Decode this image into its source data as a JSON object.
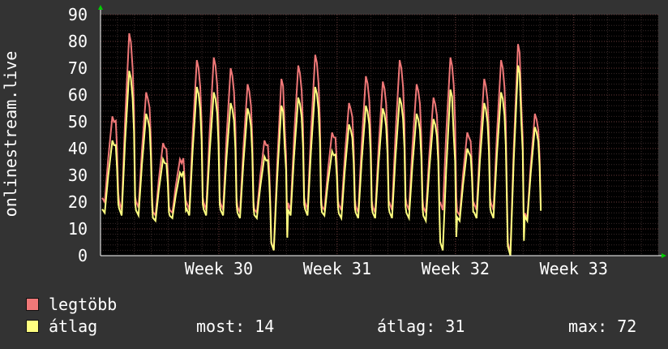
{
  "chart_data": {
    "type": "line",
    "ylabel": "onlinestream.live",
    "ylim": [
      0,
      90
    ],
    "yticks": [
      0,
      10,
      20,
      30,
      40,
      50,
      60,
      70,
      80,
      90
    ],
    "xlim": [
      "2024-07-18",
      "2024-08-20"
    ],
    "xticks": [
      {
        "label": "Week 30",
        "date": "2024-07-25"
      },
      {
        "label": "Week 31",
        "date": "2024-08-01"
      },
      {
        "label": "Week 32",
        "date": "2024-08-08"
      },
      {
        "label": "Week 33",
        "date": "2024-08-15"
      }
    ],
    "grid": true,
    "series": [
      {
        "name": "legtöbb",
        "color": "#f07878",
        "daily_peak": [
          52,
          83,
          61,
          42,
          36,
          73,
          74,
          70,
          64,
          43,
          66,
          71,
          75,
          46,
          57,
          67,
          65,
          73,
          64,
          59,
          74,
          46,
          66,
          73,
          79,
          53
        ],
        "daily_low": [
          20,
          17,
          18,
          15,
          16,
          17,
          17,
          17,
          16,
          16,
          2,
          17,
          17,
          17,
          17,
          16,
          16,
          17,
          17,
          16,
          17,
          15,
          17,
          17,
          1,
          14
        ]
      },
      {
        "name": "átlag",
        "color": "#ffff80",
        "daily_peak": [
          43,
          69,
          53,
          36,
          31,
          63,
          61,
          57,
          55,
          37,
          56,
          59,
          63,
          39,
          49,
          56,
          55,
          59,
          53,
          51,
          62,
          40,
          57,
          61,
          71,
          48
        ],
        "daily_low": [
          16,
          15,
          15,
          13,
          14,
          15,
          15,
          15,
          14,
          14,
          2,
          15,
          15,
          15,
          14,
          14,
          14,
          14,
          14,
          13,
          2,
          13,
          14,
          14,
          0,
          13
        ]
      }
    ]
  },
  "legend": {
    "max_label": "legtöbb",
    "max_color": "#f07878",
    "avg_label": "átlag",
    "avg_color": "#ffff80"
  },
  "stats": {
    "now": "most: 14",
    "avg": "átlag: 31",
    "max": "max: 72"
  }
}
